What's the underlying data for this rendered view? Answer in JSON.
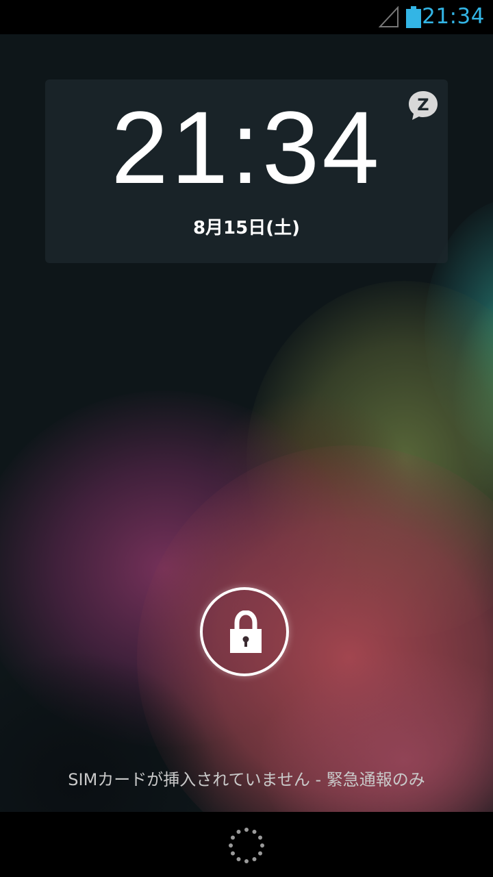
{
  "status_bar": {
    "time": "21:34",
    "icons": [
      "signal-icon",
      "battery-icon"
    ],
    "accent_color": "#33b5e5"
  },
  "lockscreen": {
    "clock": {
      "time": "21:34",
      "date": "8月15日(土)",
      "badge_letter": "Z"
    },
    "carrier_text": "SIMカードが挿入されていません - 緊急通報のみ",
    "unlock_icon": "lock-icon"
  },
  "nav_bar": {
    "icon": "loading-spinner-icon"
  }
}
